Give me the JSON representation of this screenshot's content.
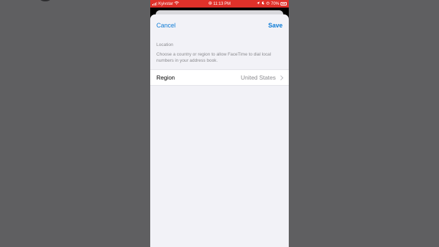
{
  "status_bar": {
    "carrier": "Kyivstar",
    "time": "11:13 PM",
    "battery": "70%",
    "background": "#e0312a"
  },
  "nav": {
    "cancel_label": "Cancel",
    "save_label": "Save"
  },
  "location_section": {
    "header": "Location",
    "description": "Choose a country or region to allow FaceTime to dial local numbers in your address book."
  },
  "region_row": {
    "label": "Region",
    "value": "United States"
  },
  "colors": {
    "accent": "#0a7ad6",
    "sheet_background": "#f2f2f7",
    "secondary_text": "#8a8a8e"
  }
}
